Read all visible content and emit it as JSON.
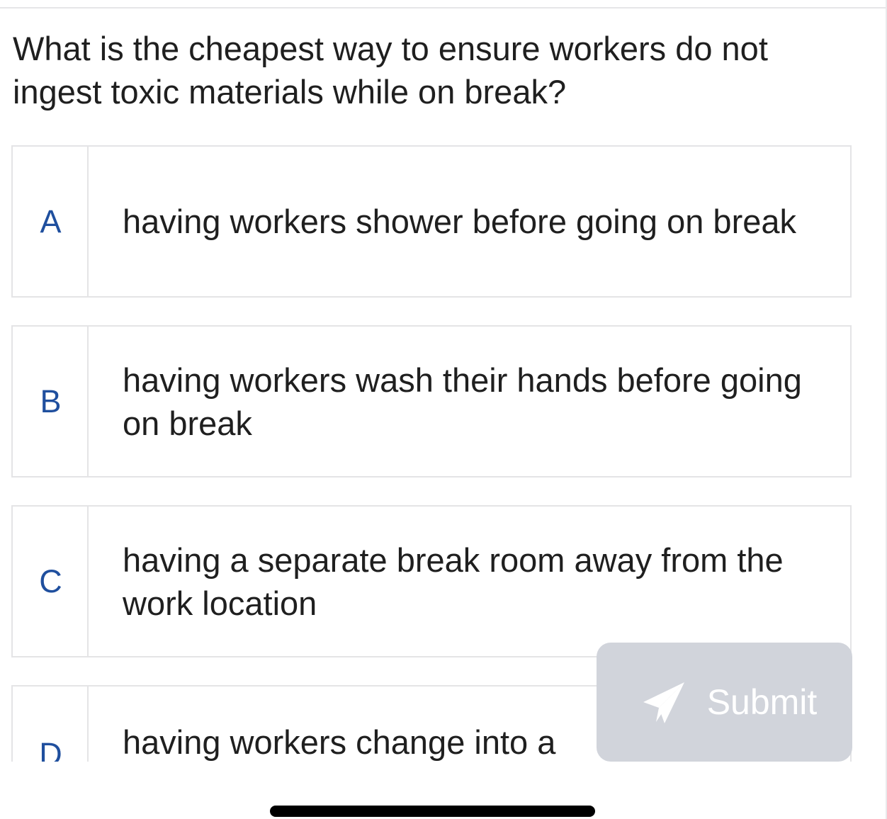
{
  "question": {
    "text": "What is the cheapest way to ensure workers do not ingest toxic materials while on break?"
  },
  "options": [
    {
      "letter": "A",
      "text": "having workers shower before going on break"
    },
    {
      "letter": "B",
      "text": "having workers wash their hands before going on break"
    },
    {
      "letter": "C",
      "text": "having a separate break room away from the work location"
    },
    {
      "letter": "D",
      "text": "having workers change into a"
    }
  ],
  "submit": {
    "label": "Submit",
    "icon": "paper-plane-icon"
  },
  "colors": {
    "accent_letter": "#1f4f9e",
    "submit_background": "#d1d4db",
    "border": "#e4e4e6"
  }
}
